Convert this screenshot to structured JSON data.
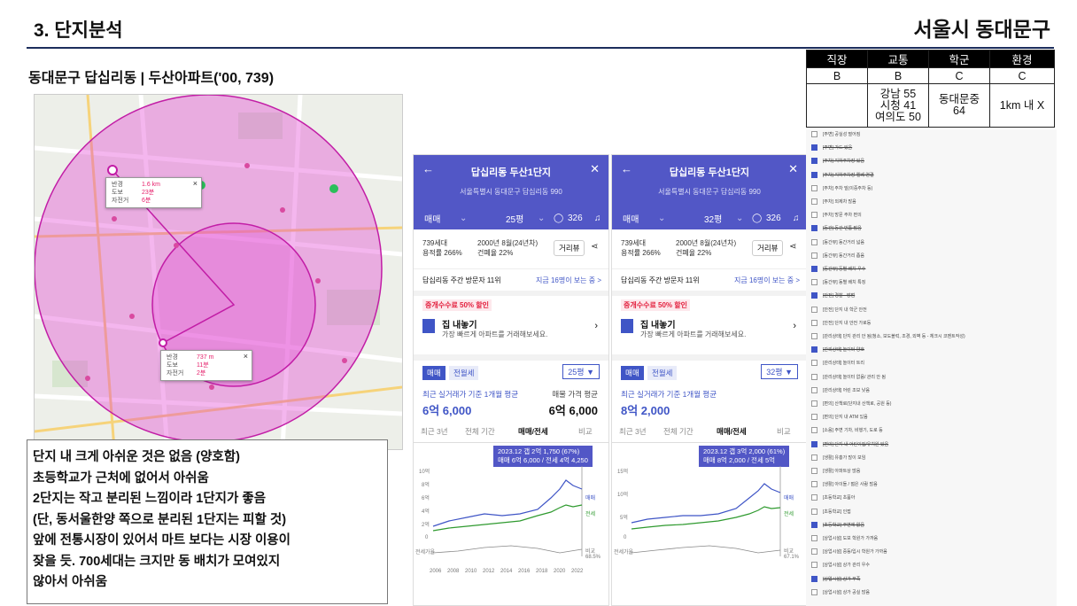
{
  "header": {
    "section_title": "3. 단지분석",
    "region": "서울시 동대문구",
    "subtitle": "동대문구 답십리동 | 두산아파트('00, 739)"
  },
  "rating_table": {
    "headers": [
      "직장",
      "교통",
      "학군",
      "환경"
    ],
    "grades": [
      "B",
      "B",
      "C",
      "C"
    ],
    "details": [
      "",
      "강남 55\n시청 41\n여의도 50",
      "동대문중\n64",
      "1km 내 X"
    ]
  },
  "map": {
    "popup1": {
      "rows": [
        [
          "반경",
          "1.6 km"
        ],
        [
          "도보",
          "23분"
        ],
        [
          "자전거",
          "6분"
        ]
      ],
      "close": "×"
    },
    "popup2": {
      "rows": [
        [
          "반경",
          "737 m"
        ],
        [
          "도보",
          "11분"
        ],
        [
          "자전거",
          "2분"
        ]
      ],
      "close": "×"
    },
    "colors": {
      "circle": "#e23fd2",
      "route": "#c21da6"
    }
  },
  "notes": [
    "단지 내 크게 아쉬운 것은 없음 (양호함)",
    "초등학교가 근처에 없어서 아쉬움",
    "2단지는 작고 분리된 느낌이라 1단지가 좋음",
    "(단, 동서울한양 쪽으로 분리된 1단지는 피할 것)",
    "앞에 전통시장이 있어서 마트 보다는 시장 이용이",
    "잦을 듯. 700세대는 크지만 동 배치가 모여있지",
    "않아서 아쉬움"
  ],
  "panels": [
    {
      "name": "답십리동 두산1단지",
      "address": "서울특별시 동대문구 답십리동 990",
      "trade": "매매",
      "pyeong": "25평",
      "comments": "326",
      "households": "739세대",
      "ratio1": "용적률 266%",
      "built": "2000년 8월(24년차)",
      "ratio2": "건폐율 22%",
      "street_btn": "거리뷰",
      "visits": "답십리동 주간 방문자 11위",
      "visits_link": "지금 16명이 보는 중 >",
      "promo_badge": "중개수수료 50% 할인",
      "promo_title": "집 내놓기",
      "promo_sub": "가장 빠르게 아파트를 거래해보세요.",
      "tab_sale": "매매",
      "tab_rent": "전월세",
      "select": "25평 ▼",
      "avg_label": "최근 실거래가 기준 1개월 평균",
      "avg_value": "6억 6,000",
      "ask_label": "매물 가격 평균",
      "ask_value": "6억 6,000",
      "periods": [
        "최근 3년",
        "전체 기간",
        "매매/전세",
        "비교"
      ],
      "tooltip1": "2023.12  갭 2억 1,750 (67%)",
      "tooltip2": "매매 6억 6,000 / 전세 4억 4,250",
      "yticks": [
        "10억",
        "8억",
        "6억",
        "4억",
        "2억",
        "0"
      ],
      "gap_label": "전세가율",
      "gap_value": "68.5%",
      "gap_name": "비교",
      "xticks": [
        "2006",
        "2008",
        "2010",
        "2012",
        "2014",
        "2016",
        "2018",
        "2020",
        "2022"
      ],
      "legend_sale": "매매",
      "legend_rent": "전세"
    },
    {
      "name": "답십리동 두산1단지",
      "address": "서울특별시 동대문구 답십리동 990",
      "trade": "매매",
      "pyeong": "32평",
      "comments": "326",
      "households": "739세대",
      "ratio1": "용적률 266%",
      "built": "2000년 8월(24년차)",
      "ratio2": "건폐율 22%",
      "street_btn": "거리뷰",
      "visits": "답십리동 주간 방문자 11위",
      "visits_link": "지금 16명이 보는 중 >",
      "promo_badge": "중개수수료 50% 할인",
      "promo_title": "집 내놓기",
      "promo_sub": "가장 빠르게 아파트를 거래해보세요.",
      "tab_sale": "매매",
      "tab_rent": "전월세",
      "select": "32평 ▼",
      "avg_label": "최근 실거래가 기준 1개월 평균",
      "avg_value": "8억 2,000",
      "ask_label": "",
      "ask_value": "",
      "periods": [
        "최근 3년",
        "전체 기간",
        "매매/전세",
        "비교"
      ],
      "tooltip1": "2023.12  갭 3억 2,000 (61%)",
      "tooltip2": "매매 8억 2,000 / 전세 5억",
      "yticks": [
        "15억",
        "10억",
        "5억",
        "0"
      ],
      "gap_label": "전세가율",
      "gap_value": "67.1%",
      "gap_name": "비교",
      "xticks": [],
      "legend_sale": "매매",
      "legend_rent": "전세"
    }
  ],
  "checklist": [
    {
      "label": "[주변] 공실성 떨어짐",
      "on": false
    },
    {
      "label": "[주변] 가드 있음",
      "on": true
    },
    {
      "label": "[주차] 지하주차장 있음",
      "on": true
    },
    {
      "label": "[주차] 지하주차장 엘베 연결",
      "on": true
    },
    {
      "label": "[주차] 주차 빌(이중주차 등)",
      "on": false
    },
    {
      "label": "[주차] 외제차 많음",
      "on": false
    },
    {
      "label": "[주차] 방문 주차 편의",
      "on": false
    },
    {
      "label": "[동간] 동간 빈틈 많음",
      "on": true
    },
    {
      "label": "[동간뷰] 동간거리 넓음",
      "on": false
    },
    {
      "label": "[동간뷰] 동간거리 좁음",
      "on": false
    },
    {
      "label": "[동간뷰] 동별 배치 우수",
      "on": true
    },
    {
      "label": "[동간뷰] 동별 배치 특징",
      "on": false
    },
    {
      "label": "[안전] 경찰 · 방범",
      "on": true
    },
    {
      "label": "[안전] 단지 내 학군 안전",
      "on": false
    },
    {
      "label": "[안전] 단지 내 안전 가로등",
      "on": false
    },
    {
      "label": "[관리상태] 단지 관리 안 됨(청소, 보도블럭, 조경, 외벽 등 - 체크시 코멘트작성)",
      "on": false
    },
    {
      "label": "[관리상태] 놀이터 양호",
      "on": true
    },
    {
      "label": "[관리상태] 놀이터 트리",
      "on": false
    },
    {
      "label": "[관리상태] 놀이터 없음/ 관리 안 됨",
      "on": false
    },
    {
      "label": "[관리상태] 어린 조보 낮음",
      "on": false
    },
    {
      "label": "[편의] 산책로(단지내 산책로, 공원 등)",
      "on": false
    },
    {
      "label": "[편의] 단지 내 ATM 있음",
      "on": false
    },
    {
      "label": "[소음] 주변 기차, 비행기, 도로 등",
      "on": false
    },
    {
      "label": "[편의] 단지 내 어린이집/유치원 있음",
      "on": true
    },
    {
      "label": "[생활] 유흥가 많이 보임",
      "on": false
    },
    {
      "label": "[생활] 아파트상 많음",
      "on": false
    },
    {
      "label": "[생활] 아이들 / 젊은 사람 많음",
      "on": false
    },
    {
      "label": "[초등학교] 초품아",
      "on": false
    },
    {
      "label": "[초등학교] 인접",
      "on": false
    },
    {
      "label": "[초등학교] 주변에 없음",
      "on": true
    },
    {
      "label": "[상업시설] 도보 학원가 가까움",
      "on": false
    },
    {
      "label": "[상업시설] 중등/입시 학원가 가까움",
      "on": false
    },
    {
      "label": "[상업시설] 상가 관리 우수",
      "on": false
    },
    {
      "label": "[상업시설] 상가 부족",
      "on": true
    },
    {
      "label": "[상업시설] 상가 공실 많음",
      "on": false
    }
  ]
}
